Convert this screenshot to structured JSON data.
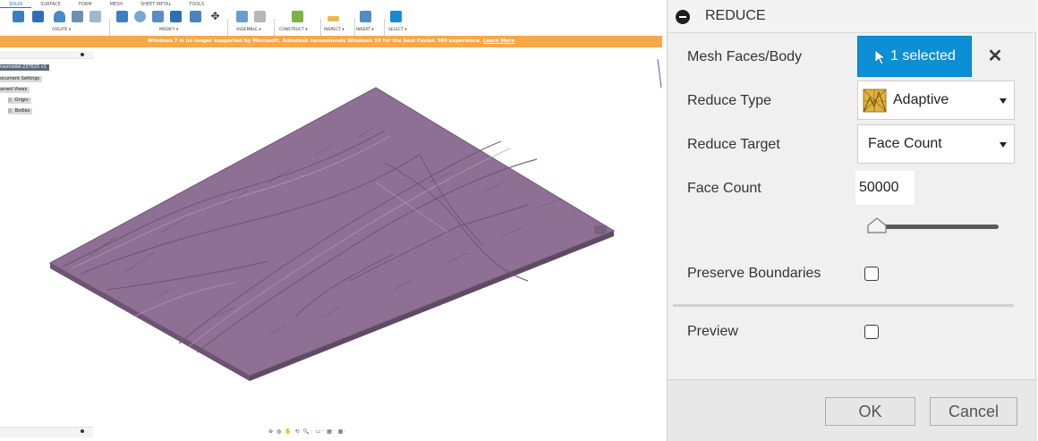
{
  "app": {
    "ribbon_tabs": [
      "SOLID",
      "SURFACE",
      "FORM",
      "MESH",
      "SHEET METAL",
      "TOOLS"
    ],
    "ribbon_groups": [
      "CREATE ▾",
      "MODIFY ▾",
      "ASSEMBLE ▾",
      "CONSTRUCT ▾",
      "INSPECT ▾",
      "INSERT ▾",
      "SELECT ▾"
    ],
    "banner": {
      "message": "Windows 7 is no longer supported by Microsoft. Autodesk recommends Windows 10 for the best Fusion 360 experience.",
      "link": "Learn More"
    },
    "browser": {
      "items": [
        "rasmodel-237625 v1",
        "ocument Settings",
        "amed Views",
        "Origin",
        "Bodies"
      ]
    },
    "nav_toolbar": "⊕·◍ ✋ ⟲ 🔍· ▭· ▦· ▦·",
    "colors": {
      "mesh": "#8e6f93",
      "accent": "#0d8fd8",
      "banner": "#f6a84a"
    }
  },
  "dialog": {
    "title": "REDUCE",
    "rows": {
      "mesh_faces_label": "Mesh Faces/Body",
      "selected_label": "1 selected",
      "reduce_type_label": "Reduce Type",
      "reduce_type_value": "Adaptive",
      "reduce_target_label": "Reduce Target",
      "reduce_target_value": "Face Count",
      "face_count_label": "Face Count",
      "face_count_value": "50000",
      "preserve_label": "Preserve Boundaries",
      "preview_label": "Preview"
    },
    "buttons": {
      "ok": "OK",
      "cancel": "Cancel"
    }
  }
}
